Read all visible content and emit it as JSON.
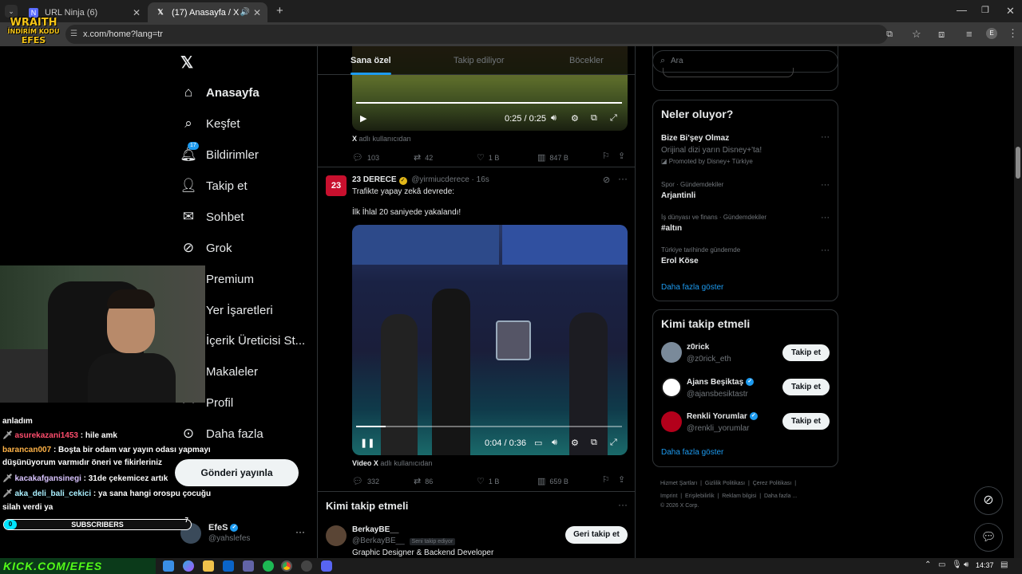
{
  "browser": {
    "tabs": [
      {
        "title": "URL Ninja (6)",
        "active": false
      },
      {
        "title": "(17) Anasayfa / X",
        "active": true
      }
    ],
    "url": "x.com/home?lang=tr",
    "profile_letter": "E"
  },
  "stream_overlay": {
    "logo_line1": "WRAITH",
    "logo_line2": "İNDİRİM KODU",
    "logo_line3": "EFES",
    "subscribers_label": "SUBSCRIBERS",
    "subscribers_start": "0",
    "subscribers_goal": "7",
    "subscribers_progress": 0,
    "bottom_banner": "KICK.COM/EFES",
    "chat": [
      {
        "name": "",
        "text": "anladım",
        "name_color": "#ffffff"
      },
      {
        "name": "asurekazani1453",
        "text": ": hile amk",
        "name_color": "#ff4d6d"
      },
      {
        "name": "barancan007",
        "text": ": Boşta bir odam var yayın odası yapmayı",
        "name_color": "#ffb347"
      },
      {
        "name": "",
        "text": "düşünüyorum varmıdır öneri ve fikirleriniz",
        "name_color": "#ffffff"
      },
      {
        "name": "kacakafgansinegi",
        "text": ": 31de çekemicez artık",
        "name_color": "#d9c4ff"
      },
      {
        "name": "aka_deli_bali_cekici",
        "text": ": ya sana hangi orospu çocuğu",
        "name_color": "#aaf0ff"
      },
      {
        "name": "",
        "text": "silah verdi ya",
        "name_color": "#ffffff"
      }
    ]
  },
  "sidebar": {
    "items": [
      {
        "label": "Anasayfa",
        "icon": "home-icon"
      },
      {
        "label": "Keşfet",
        "icon": "search-icon"
      },
      {
        "label": "Bildirimler",
        "icon": "bell-icon",
        "badge": "17"
      },
      {
        "label": "Takip et",
        "icon": "add-person-icon"
      },
      {
        "label": "Sohbet",
        "icon": "envelope-icon"
      },
      {
        "label": "Grok",
        "icon": "grok-icon"
      },
      {
        "label": "Premium",
        "icon": "x-premium-icon"
      },
      {
        "label": "Yer İşaretleri",
        "icon": "bookmark-icon"
      },
      {
        "label": "İçerik Üreticisi St...",
        "icon": "studio-icon"
      },
      {
        "label": "Makaleler",
        "icon": "article-icon"
      },
      {
        "label": "Profil",
        "icon": "person-icon"
      },
      {
        "label": "Daha fazla",
        "icon": "more-circle-icon"
      }
    ],
    "post_button": "Gönderi yayınla",
    "account": {
      "name": "EfeS",
      "handle": "@yahslefes"
    }
  },
  "feed": {
    "tabs": [
      "Sana özel",
      "Takip ediliyor",
      "Böcekler"
    ],
    "post1": {
      "video_time": "0:25 / 0:25",
      "video_progress": 1.0,
      "source_prefix": "X",
      "source_suffix": "adlı kullanıcıdan",
      "replies": "103",
      "reposts": "42",
      "likes": "1 B",
      "views": "847 B"
    },
    "post2": {
      "author": "23 DERECE",
      "handle": "@yirmiucderece",
      "time": "· 16s",
      "avatar_text": "23",
      "text1": "Trafikte yapay zekâ devrede:",
      "text2": "İlk İhlal 20 saniyede yakalandı!",
      "video_time": "0:04 / 0:36",
      "video_progress": 0.11,
      "source_prefix": "Video X",
      "source_suffix": "adlı kullanıcıdan",
      "replies": "332",
      "reposts": "86",
      "likes": "1 B",
      "views": "659 B"
    },
    "follow_section": {
      "title": "Kimi takip etmeli",
      "user": {
        "name": "BerkayBE__",
        "handle": "@BerkayBE__",
        "badge": "Seni takip ediyor",
        "bio": "Graphic Designer & Backend Developer",
        "button": "Geri takip et"
      }
    }
  },
  "right": {
    "search_placeholder": "Ara",
    "trending_title": "Neler oluyor?",
    "trends": [
      {
        "title": "Bize Bi'şey Olmaz",
        "desc": "Orijinal dizi yarın Disney+'ta!",
        "promoted": "Promoted by Disney+ Türkiye"
      },
      {
        "category": "Spor · Gündemdekiler",
        "title": "Arjantinli"
      },
      {
        "category": "İş dünyası ve finans · Gündemdekiler",
        "title": "#altın"
      },
      {
        "category": "Türkiye tarihinde gündemde",
        "title": "Erol Köse"
      }
    ],
    "show_more": "Daha fazla göster",
    "who_to_follow_title": "Kimi takip etmeli",
    "suggestions": [
      {
        "name": "z0rick",
        "handle": "@z0rick_eth",
        "verified": false,
        "button": "Takip et"
      },
      {
        "name": "Ajans Beşiktaş",
        "handle": "@ajansbesiktastr",
        "verified": true,
        "button": "Takip et"
      },
      {
        "name": "Renkli Yorumlar",
        "handle": "@renkli_yorumlar",
        "verified": true,
        "button": "Takip et"
      }
    ],
    "show_more2": "Daha fazla göster",
    "footer": [
      "Hizmet Şartları",
      "Gizlilik Politikası",
      "Çerez Politikası",
      "Imprint",
      "Erişilebilirlik",
      "Reklam bilgisi",
      "Daha fazla ...",
      "© 2026 X Corp."
    ]
  },
  "taskbar": {
    "time": "14:37"
  },
  "colors": {
    "accent": "#1d9bf0",
    "bg": "#000000",
    "border": "#2f3336",
    "muted": "#71767b"
  }
}
